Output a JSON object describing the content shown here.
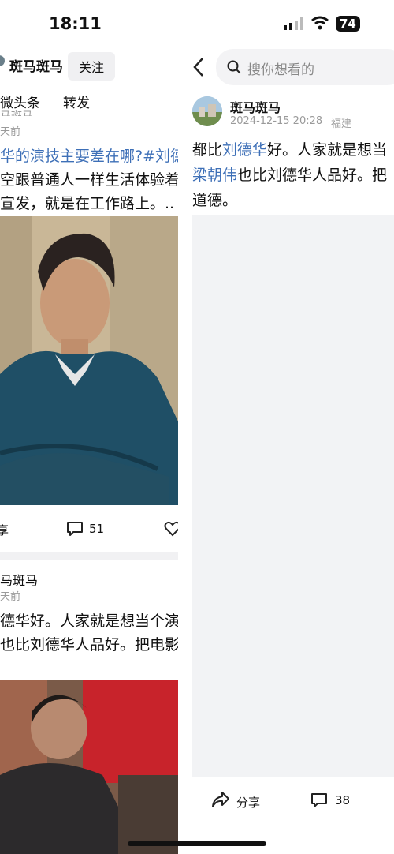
{
  "status_bar": {
    "time": "18:11",
    "battery": "74"
  },
  "left_feed": {
    "author": "斑马斑马",
    "follow_label": "关注",
    "tabs": [
      "微头条",
      "转发"
    ],
    "post1": {
      "partial_author": "马斑马",
      "partial_time": "天前",
      "line1_hashtag": "华的演技主要差在哪?#刘德",
      "line2": "空跟普通人一样生活体验着",
      "line3": "宣发，就是在工作路上。..",
      "share_label": "享",
      "comment_count": "51"
    },
    "post2": {
      "author": "马斑马",
      "time": "天前",
      "line1": "德华好。人家就是想当个演",
      "line2": "也比刘德华人品好。把电影"
    }
  },
  "right_detail": {
    "search_placeholder": "搜你想看的",
    "author": "斑马斑马",
    "datetime": "2024-12-15 20:28",
    "location": "福建",
    "text_line1_prefix": "都比",
    "text_line1_link": "刘德华",
    "text_line1_suffix": "好。人家就是想当",
    "text_line2_link": "梁朝伟",
    "text_line2_suffix": "也比刘德华人品好。把",
    "text_line3": "道德。",
    "share_label": "分享",
    "comment_count": "38"
  },
  "colors": {
    "link_blue": "#3d6fb7",
    "meta_gray": "#9a9a9a",
    "panel_bg": "#f2f3f5"
  }
}
